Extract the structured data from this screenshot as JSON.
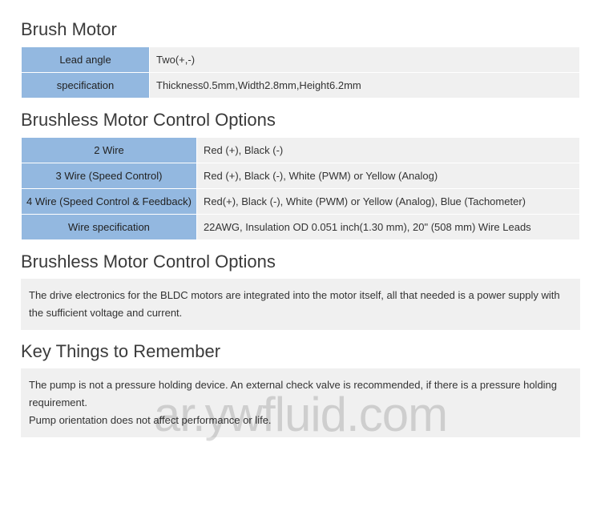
{
  "section1": {
    "title": "Brush Motor",
    "rows": [
      {
        "label": "Lead angle",
        "value": "Two(+,-)"
      },
      {
        "label": "specification",
        "value": "Thickness0.5mm,Width2.8mm,Height6.2mm"
      }
    ]
  },
  "section2": {
    "title": "Brushless Motor Control Options",
    "rows": [
      {
        "label": "2 Wire",
        "value": "Red (+), Black (-)"
      },
      {
        "label": "3 Wire (Speed Control)",
        "value": "Red (+), Black (-), White (PWM) or Yellow (Analog)"
      },
      {
        "label": "4 Wire (Speed Control & Feedback)",
        "value": "Red(+), Black (-), White (PWM) or Yellow (Analog), Blue (Tachometer)"
      },
      {
        "label": "Wire specification",
        "value": "22AWG, Insulation OD 0.051 inch(1.30 mm), 20\" (508 mm) Wire Leads"
      }
    ],
    "labelWidth": "198px"
  },
  "section3": {
    "title": "Brushless Motor Control Options",
    "text": "The drive electronics for the BLDC motors are integrated into the motor itself, all that needed is a power supply with the sufficient voltage and current."
  },
  "section4": {
    "title": "Key Things to Remember",
    "lines": [
      "The pump is not a pressure holding device. An external check valve is recommended, if there is a pressure holding requirement.",
      "Pump orientation does not affect performance or life."
    ]
  },
  "watermark": "ar.ywfluid.com"
}
